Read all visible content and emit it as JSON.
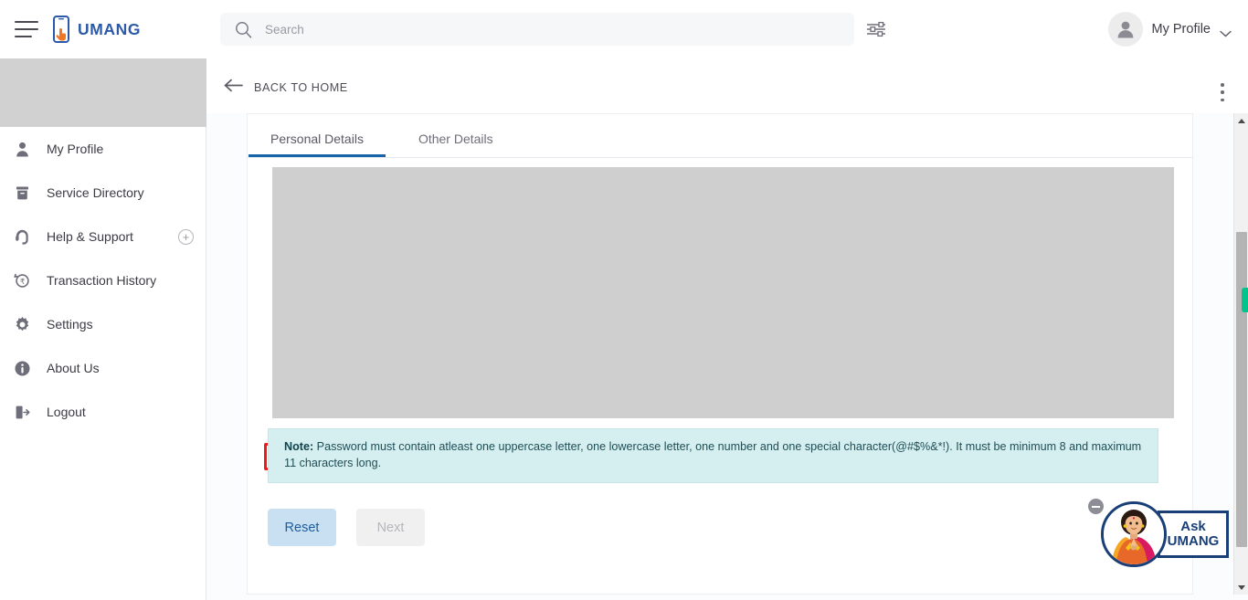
{
  "header": {
    "brand": "UMANG",
    "brand_color": "#2c5aa8",
    "menu_icon": "hamburger-icon",
    "search": {
      "placeholder": "Search",
      "value": "",
      "icon": "search-icon"
    },
    "filter_icon": "filter-sliders-icon",
    "profile": {
      "label": "My Profile",
      "avatar_icon": "user-avatar-icon",
      "chevron_icon": "chevron-down-icon"
    }
  },
  "sidebar": {
    "masked_block": true,
    "items": [
      {
        "label": "My Profile",
        "icon": "user-icon",
        "expandable": false
      },
      {
        "label": "Service Directory",
        "icon": "archive-box-icon",
        "expandable": false
      },
      {
        "label": "Help & Support",
        "icon": "headset-icon",
        "expandable": true,
        "expand_glyph": "+"
      },
      {
        "label": "Transaction History",
        "icon": "history-rupee-icon",
        "expandable": false
      },
      {
        "label": "Settings",
        "icon": "gear-icon",
        "expandable": false
      },
      {
        "label": "About Us",
        "icon": "info-icon",
        "expandable": false
      },
      {
        "label": "Logout",
        "icon": "logout-icon",
        "expandable": false
      }
    ]
  },
  "content": {
    "back_label": "BACK TO HOME",
    "back_icon": "arrow-left-icon",
    "overflow_icon": "kebab-menu-icon",
    "tabs": [
      {
        "label": "Personal Details",
        "active": true
      },
      {
        "label": "Other Details",
        "active": false
      }
    ],
    "active_tab_underline_color": "#1565a8",
    "form_masked": true,
    "error_field_outline_color": "#ef1b1b",
    "note": {
      "prefix": "Note:",
      "text": " Password must contain atleast one uppercase letter, one lowercase letter, one number and one special character(@#$%&*!). It must be minimum 8 and maximum 11 characters long.",
      "background": "#d5eef0"
    },
    "buttons": {
      "reset": "Reset",
      "next": "Next"
    },
    "scrollbar": {
      "up_icon": "scroll-up-arrow-icon",
      "down_icon": "scroll-down-arrow-icon"
    }
  },
  "chat_widget": {
    "line1": "Ask",
    "line2": "UMANG",
    "avatar_icon": "namaste-woman-icon",
    "minimize_icon": "minimize-icon"
  },
  "feedback_tab": {
    "color": "#00c48c"
  }
}
